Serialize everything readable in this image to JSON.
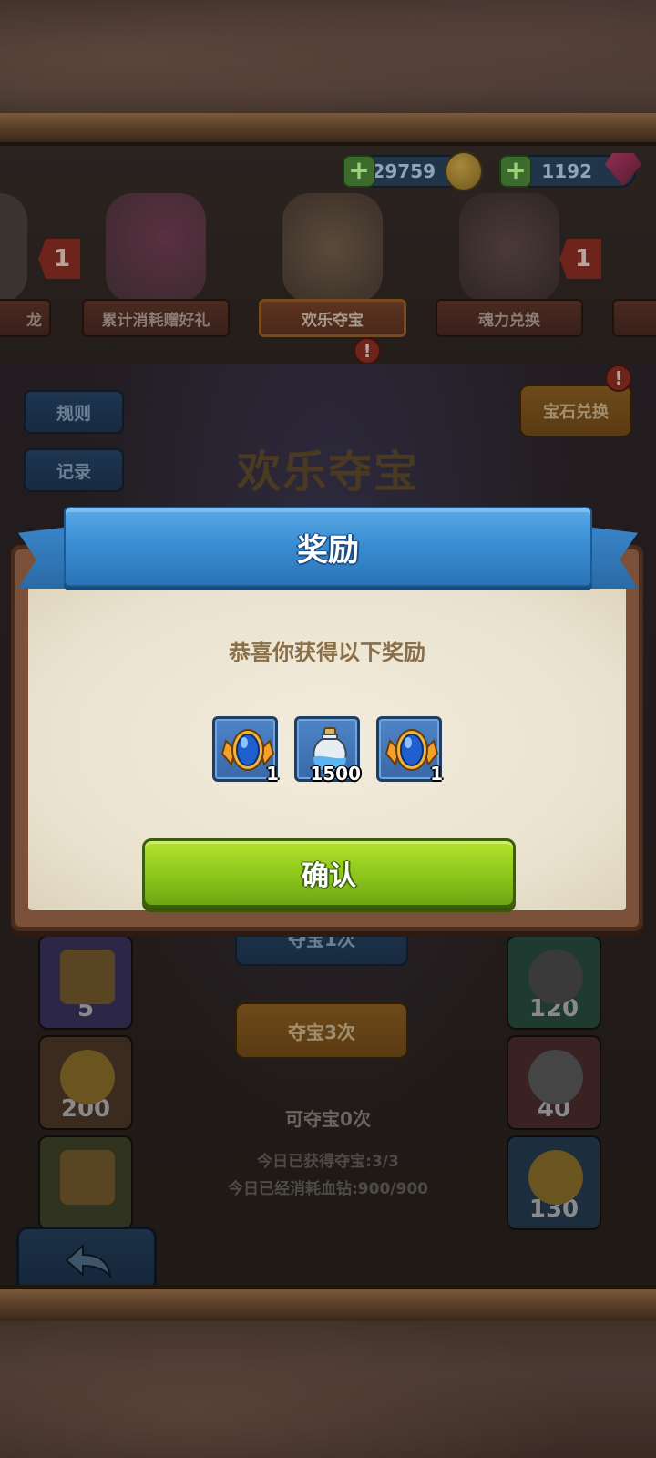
{
  "currency": {
    "coins": "29759",
    "gems": "1192"
  },
  "event_tabs": [
    {
      "label": "龙",
      "badge": ""
    },
    {
      "label": "累计消耗赠好礼",
      "badge": "1"
    },
    {
      "label": "欢乐夺宝",
      "badge": "!"
    },
    {
      "label": "魂力兑换",
      "badge": "1"
    }
  ],
  "board": {
    "rules_label": "规则",
    "records_label": "记录",
    "gem_exchange_label": "宝石兑换",
    "gem_exchange_badge": "!",
    "title": "欢乐夺宝",
    "draw_once_label": "夺宝1次",
    "draw_three_label": "夺宝3次",
    "remaining_text": "可夺宝0次",
    "today_obtained_text": "今日已获得夺宝:3/3",
    "today_spent_text": "今日已经消耗血钻:900/900",
    "left_column_values": [
      "5",
      "200",
      ""
    ],
    "right_column_values": [
      "120",
      "40",
      "130"
    ]
  },
  "modal": {
    "title": "奖励",
    "subtitle": "恭喜你获得以下奖励",
    "rewards": [
      {
        "icon": "blue-gem-medal-icon",
        "quantity": "1"
      },
      {
        "icon": "potion-bottle-icon",
        "quantity": "1500"
      },
      {
        "icon": "blue-gem-medal-icon",
        "quantity": "1"
      }
    ],
    "confirm_label": "确认"
  },
  "colors": {
    "ribbon_blue": "#3b8ed4",
    "confirm_green": "#8cc51b",
    "paper": "#eae2cf",
    "reward_tile_blue": "#4e84c6"
  }
}
